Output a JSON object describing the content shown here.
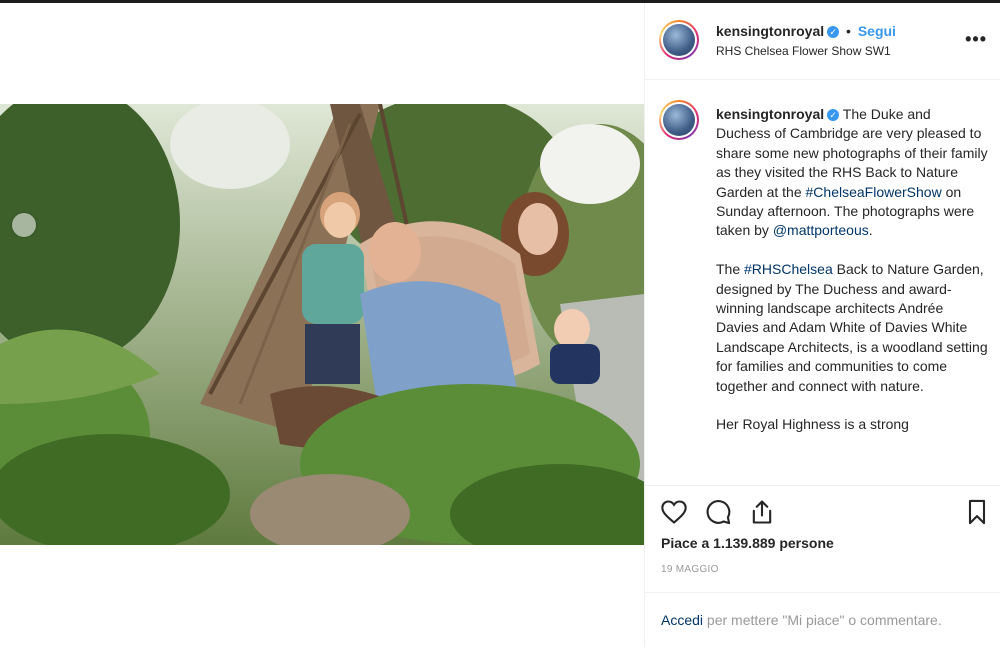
{
  "post": {
    "username": "kensingtonroyal",
    "follow_label": "Segui",
    "location": "RHS Chelsea Flower Show SW1",
    "more_label": "•••",
    "dot_separator": "•",
    "verified_glyph": "✓"
  },
  "caption": {
    "username": "kensingtonroyal",
    "p1_part1": " The Duke and Duchess of Cambridge are very pleased to share some new photographs of their family as they visited the RHS Back to Nature Garden at the ",
    "p1_tag1": "#ChelseaFlowerShow",
    "p1_part2": " on Sunday afternoon. The photographs were taken by ",
    "p1_tag2": "@mattporteous",
    "p1_part3": ".",
    "p2_part1": "The ",
    "p2_tag1": "#RHSChelsea",
    "p2_part2": " Back to Nature Garden, designed by The Duchess and award-winning landscape architects Andrée Davies and Adam White of Davies White Landscape Architects, is a woodland setting for families and communities to come together and connect with nature.",
    "p3": "Her Royal Highness is a strong"
  },
  "stats": {
    "likes": "Piace a 1.139.889 persone",
    "date": "19 MAGGIO"
  },
  "login": {
    "link": "Accedi",
    "rest": " per mettere \"Mi piace\" o commentare."
  },
  "icons": [
    "heart-icon",
    "comment-icon",
    "share-icon",
    "bookmark-icon",
    "more-options-icon",
    "verified-badge-icon",
    "carousel-prev-icon"
  ],
  "colors": {
    "link_blue": "#3897f0",
    "hashtag_dark_blue": "#003569",
    "text": "#262626",
    "muted": "#999999",
    "border": "#efefef",
    "verified": "#3897f0"
  }
}
